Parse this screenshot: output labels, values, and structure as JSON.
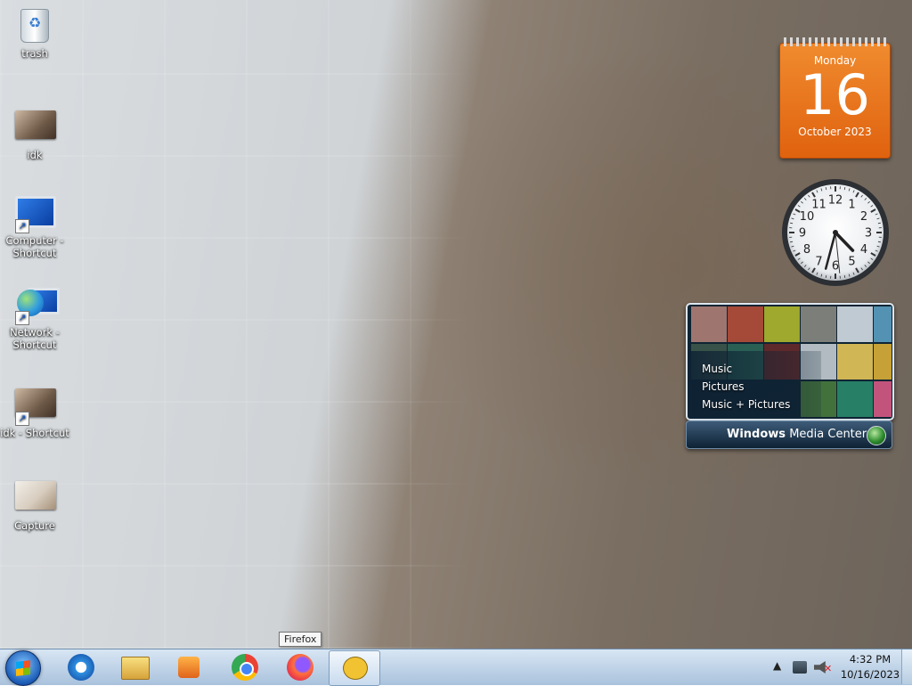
{
  "desktop": {
    "icons": [
      {
        "label": "trash",
        "icon": "recycle-bin-icon"
      },
      {
        "label": "idk",
        "icon": "image-thumbnail-icon"
      },
      {
        "label": "Computer - Shortcut",
        "icon": "computer-icon"
      },
      {
        "label": "Network - Shortcut",
        "icon": "network-icon"
      },
      {
        "label": "idk - Shortcut",
        "icon": "image-thumbnail-icon"
      },
      {
        "label": "Capture",
        "icon": "image-thumbnail-icon"
      }
    ]
  },
  "gadgets": {
    "calendar": {
      "weekday": "Monday",
      "day": "16",
      "month_year": "October 2023"
    },
    "clock": {
      "hour": 4,
      "minute": 32,
      "second": 29,
      "numerals": [
        "12",
        "1",
        "2",
        "3",
        "4",
        "5",
        "6",
        "7",
        "8",
        "9",
        "10",
        "11"
      ]
    },
    "media_center": {
      "items": [
        "Music",
        "Pictures",
        "Music + Pictures"
      ],
      "brand_bold": "Windows",
      "brand_light": "Media Center"
    }
  },
  "taskbar": {
    "pinned": [
      {
        "name": "Internet Explorer",
        "icon": "internet-explorer-icon"
      },
      {
        "name": "Windows Explorer",
        "icon": "folder-icon"
      },
      {
        "name": "Windows Media Player",
        "icon": "media-player-icon"
      },
      {
        "name": "Chrome",
        "icon": "chrome-icon"
      },
      {
        "name": "Firefox",
        "icon": "firefox-icon"
      },
      {
        "name": "Messenger",
        "icon": "speech-bubble-icon"
      }
    ],
    "tooltip": "Firefox",
    "tray": {
      "time": "4:32 PM",
      "date": "10/16/2023"
    },
    "colors": {
      "accent": "#1b5bb5",
      "calendar": "#e8711a"
    }
  }
}
